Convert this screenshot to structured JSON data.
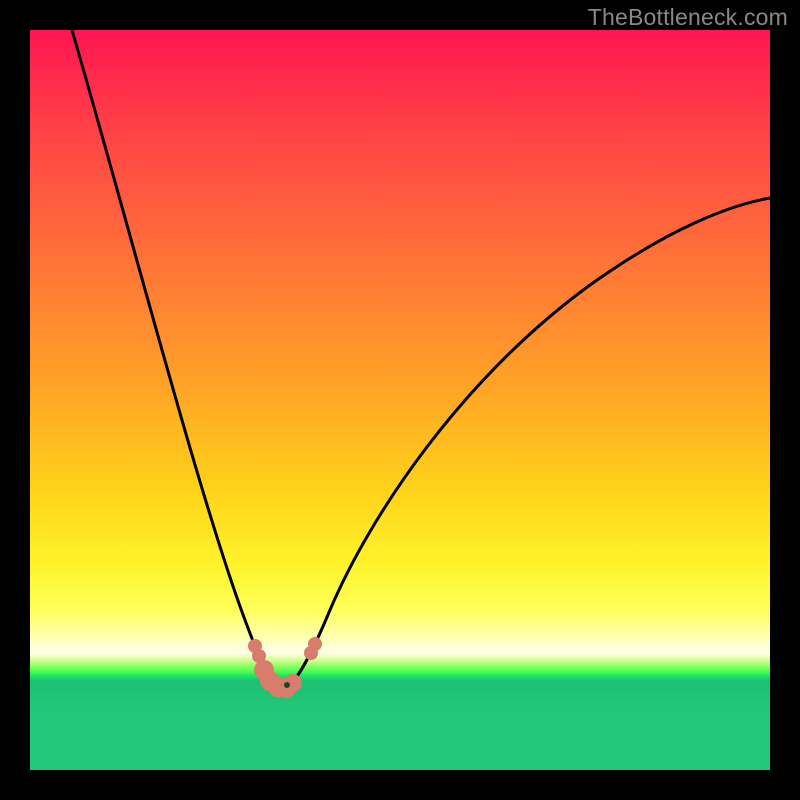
{
  "watermark": "TheBottleneck.com",
  "chart_data": {
    "type": "line",
    "title": "",
    "xlabel": "",
    "ylabel": "",
    "xlim": [
      0,
      100
    ],
    "ylim": [
      0,
      100
    ],
    "grid": false,
    "series": [
      {
        "name": "bottleneck-curve",
        "x": [
          5,
          10,
          16,
          22,
          26,
          29,
          31,
          32,
          33,
          34,
          36,
          39,
          45,
          55,
          70,
          85,
          100
        ],
        "y": [
          100,
          80,
          54,
          28,
          14,
          5,
          1,
          0,
          0,
          0,
          2,
          8,
          20,
          36,
          52,
          62,
          68
        ]
      }
    ],
    "min_point": {
      "x": 33,
      "y": 0
    },
    "bead_segments": [
      {
        "from_x": 30.5,
        "to_x": 31.0
      },
      {
        "from_x": 31.5,
        "to_x": 33.8
      },
      {
        "from_x": 35.0,
        "to_x": 35.6
      }
    ]
  },
  "gradient_stops": [
    {
      "pct": 0,
      "color": "#ff1552"
    },
    {
      "pct": 50,
      "color": "#ffc020"
    },
    {
      "pct": 82,
      "color": "#ffff80"
    },
    {
      "pct": 88,
      "color": "#22c877"
    },
    {
      "pct": 100,
      "color": "#22c877"
    }
  ]
}
